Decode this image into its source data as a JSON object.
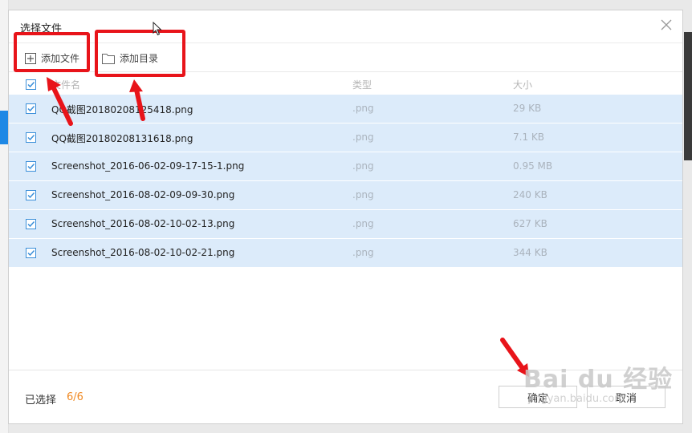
{
  "dialog": {
    "title": "选择文件",
    "close_icon": "close-icon"
  },
  "toolbar": {
    "add_file_label": "添加文件",
    "add_dir_label": "添加目录"
  },
  "table": {
    "columns": [
      "文件名",
      "类型",
      "大小"
    ],
    "rows": [
      {
        "name": "QQ截图20180208125418.png",
        "type": ".png",
        "size": "29 KB",
        "checked": true
      },
      {
        "name": "QQ截图20180208131618.png",
        "type": ".png",
        "size": "7.1 KB",
        "checked": true
      },
      {
        "name": "Screenshot_2016-06-02-09-17-15-1.png",
        "type": ".png",
        "size": "0.95 MB",
        "checked": true
      },
      {
        "name": "Screenshot_2016-08-02-09-09-30.png",
        "type": ".png",
        "size": "240 KB",
        "checked": true
      },
      {
        "name": "Screenshot_2016-08-02-10-02-13.png",
        "type": ".png",
        "size": "627 KB",
        "checked": true
      },
      {
        "name": "Screenshot_2016-08-02-10-02-21.png",
        "type": ".png",
        "size": "344 KB",
        "checked": true
      }
    ]
  },
  "footer": {
    "selected_label": "已选择",
    "selected_count": "6/6",
    "ok_label": "确定",
    "cancel_label": "取消"
  },
  "watermark": {
    "top": "Bai du 经验",
    "bottom": "jingyan.baidu.com"
  },
  "colors": {
    "accent": "#3b8fd9",
    "row_selected": "#dcebfa",
    "count": "#f08a24",
    "annotation": "#e8141a"
  }
}
